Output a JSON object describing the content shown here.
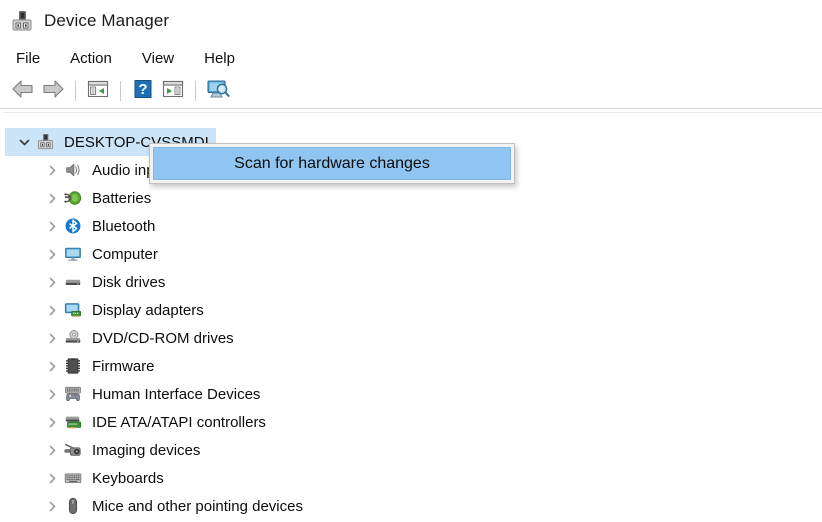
{
  "window": {
    "title": "Device Manager",
    "icon": "device-manager-icon"
  },
  "menubar": {
    "items": [
      {
        "label": "File",
        "name": "menu-file"
      },
      {
        "label": "Action",
        "name": "menu-action"
      },
      {
        "label": "View",
        "name": "menu-view"
      },
      {
        "label": "Help",
        "name": "menu-help"
      }
    ]
  },
  "toolbar": {
    "buttons": [
      {
        "icon": "back-arrow-icon",
        "name": "toolbar-back"
      },
      {
        "icon": "forward-arrow-icon",
        "name": "toolbar-forward"
      },
      {
        "icon": "properties-icon",
        "name": "toolbar-properties"
      },
      {
        "icon": "help-icon",
        "name": "toolbar-help"
      },
      {
        "icon": "update-driver-icon",
        "name": "toolbar-update-driver"
      },
      {
        "icon": "scan-hardware-icon",
        "name": "toolbar-scan-hardware"
      }
    ]
  },
  "tree": {
    "root": {
      "label": "DESKTOP-CVSSMDI",
      "icon": "computer-root-icon",
      "expanded": true,
      "selected": true
    },
    "items": [
      {
        "label": "Audio inputs and outputs",
        "icon": "speaker-icon"
      },
      {
        "label": "Batteries",
        "icon": "battery-icon"
      },
      {
        "label": "Bluetooth",
        "icon": "bluetooth-icon"
      },
      {
        "label": "Computer",
        "icon": "monitor-icon"
      },
      {
        "label": "Disk drives",
        "icon": "disk-drive-icon"
      },
      {
        "label": "Display adapters",
        "icon": "display-adapter-icon"
      },
      {
        "label": "DVD/CD-ROM drives",
        "icon": "dvd-drive-icon"
      },
      {
        "label": "Firmware",
        "icon": "firmware-chip-icon"
      },
      {
        "label": "Human Interface Devices",
        "icon": "hid-icon"
      },
      {
        "label": "IDE ATA/ATAPI controllers",
        "icon": "ide-controller-icon"
      },
      {
        "label": "Imaging devices",
        "icon": "imaging-device-icon"
      },
      {
        "label": "Keyboards",
        "icon": "keyboard-icon"
      },
      {
        "label": "Mice and other pointing devices",
        "icon": "mouse-icon"
      }
    ]
  },
  "context_menu": {
    "items": [
      {
        "label": "Scan for hardware changes",
        "highlighted": true
      }
    ]
  },
  "colors": {
    "selection_blue": "#cce4f7",
    "menu_highlight_blue": "#8fc5f0",
    "chevron_gray": "#9a9a9a",
    "bluetooth_blue": "#1878d0",
    "battery_green": "#4c9a2a",
    "toolbar_help_blue": "#1f6fb5"
  }
}
